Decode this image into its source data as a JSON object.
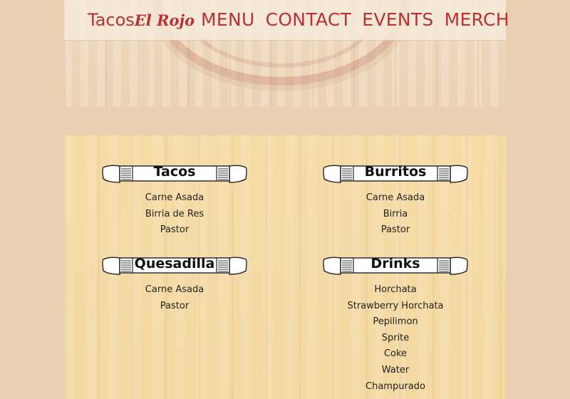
{
  "header": {
    "brand_part1": "Tacos",
    "brand_part2": "El Rojo",
    "nav": [
      "MENU",
      "CONTACT",
      "EVENTS",
      "MERCH"
    ]
  },
  "colors": {
    "accent": "#b73232",
    "page_bg": "#e9d0b3",
    "panel_bg": "#f4d9a4"
  },
  "menu": {
    "sections": [
      {
        "title": "Tacos",
        "items": [
          "Carne Asada",
          "Birria de Res",
          "Pastor"
        ]
      },
      {
        "title": "Burritos",
        "items": [
          "Carne Asada",
          "Birria",
          "Pastor"
        ]
      },
      {
        "title": "Quesadilla",
        "items": [
          "Carne Asada",
          "Pastor"
        ]
      },
      {
        "title": "Drinks",
        "items": [
          "Horchata",
          "Strawberry Horchata",
          "Pepilimon",
          "Sprite",
          "Coke",
          "Water",
          "Champurado"
        ]
      }
    ]
  }
}
